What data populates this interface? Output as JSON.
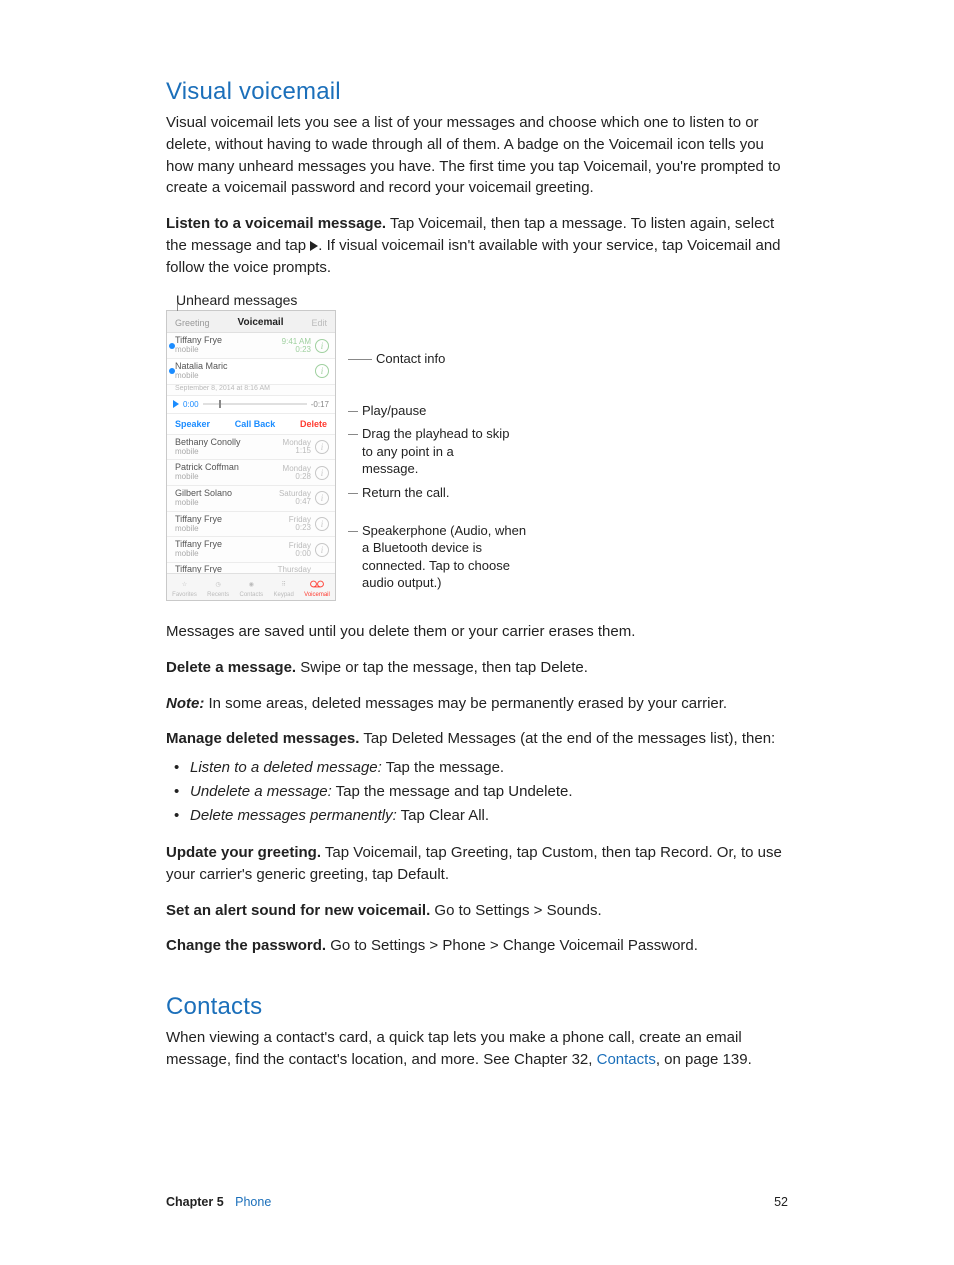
{
  "section1": {
    "title": "Visual voicemail",
    "intro": "Visual voicemail lets you see a list of your messages and choose which one to listen to or delete, without having to wade through all of them. A badge on the Voicemail icon tells you how many unheard messages you have. The first time you tap Voicemail, you're prompted to create a voicemail password and record your voicemail greeting.",
    "listen_bold": "Listen to a voicemail message.",
    "listen_rest_a": " Tap Voicemail, then tap a message. To listen again, select the message and tap ",
    "listen_rest_b": ". If visual voicemail isn't available with your service, tap Voicemail and follow the voice prompts."
  },
  "figure": {
    "top_caption": "Unheard messages",
    "header_greeting": "Greeting",
    "header_title": "Voicemail",
    "header_edit": "Edit",
    "rows": [
      {
        "name": "Tiffany Frye",
        "sub": "mobile",
        "ts1": "9:41 AM",
        "ts2": "0:23",
        "dot": true,
        "ts_grey": false
      },
      {
        "name": "Natalia Maric",
        "sub": "mobile",
        "ts1": "",
        "ts2": "",
        "dot": true,
        "ts_grey": false,
        "date_below": "September 8, 2014 at 8:16 AM"
      }
    ],
    "scrub_t0": "0:00",
    "scrub_t1": "-0:17",
    "actions": {
      "speaker": "Speaker",
      "callback": "Call Back",
      "delete": "Delete"
    },
    "rows2": [
      {
        "name": "Bethany Conolly",
        "sub": "mobile",
        "ts1": "Monday",
        "ts2": "1:15"
      },
      {
        "name": "Patrick Coffman",
        "sub": "mobile",
        "ts1": "Monday",
        "ts2": "0:28"
      },
      {
        "name": "Gilbert Solano",
        "sub": "mobile",
        "ts1": "Saturday",
        "ts2": "0:47"
      },
      {
        "name": "Tiffany Frye",
        "sub": "mobile",
        "ts1": "Friday",
        "ts2": "0:23"
      },
      {
        "name": "Tiffany Frye",
        "sub": "mobile",
        "ts1": "Friday",
        "ts2": "0:00"
      },
      {
        "name": "Tiffany Frye",
        "sub": "",
        "ts1": "Thursday",
        "ts2": ""
      }
    ],
    "tabs": [
      "Favorites",
      "Recents",
      "Contacts",
      "Keypad",
      "Voicemail"
    ],
    "callouts": {
      "contact_info": "Contact info",
      "play_pause": "Play/pause",
      "drag": "Drag the playhead to skip to any point in a message.",
      "return_call": "Return the call.",
      "speaker": "Speakerphone (Audio, when a Bluetooth device is connected. Tap to choose audio output.)"
    }
  },
  "after_fig": {
    "saved": "Messages are saved until you delete them or your carrier erases them.",
    "delete_bold": "Delete a message.",
    "delete_rest": " Swipe or tap the message, then tap Delete.",
    "note_label": "Note:  ",
    "note_rest": "In some areas, deleted messages may be permanently erased by your carrier.",
    "manage_bold": "Manage deleted messages.",
    "manage_rest": " Tap Deleted Messages (at the end of the messages list), then:",
    "bullets": [
      {
        "em": "Listen to a deleted message:",
        "rest": "  Tap the message."
      },
      {
        "em": "Undelete a message:",
        "rest": "  Tap the message and tap Undelete."
      },
      {
        "em": "Delete messages permanently:",
        "rest": "  Tap Clear All."
      }
    ],
    "update_bold": "Update your greeting.",
    "update_rest": " Tap Voicemail, tap Greeting, tap Custom, then tap Record. Or, to use your carrier's generic greeting, tap Default.",
    "alert_bold": "Set an alert sound for new voicemail.",
    "alert_rest": " Go to Settings > Sounds.",
    "pwd_bold": "Change the password.",
    "pwd_rest": " Go to Settings > Phone > Change Voicemail Password."
  },
  "section2": {
    "title": "Contacts",
    "body_a": "When viewing a contact's card, a quick tap lets you make a phone call, create an email message, find the contact's location, and more. See Chapter 32, ",
    "link": "Contacts",
    "body_b": ", on page 139."
  },
  "footer": {
    "chapter": "Chapter  5",
    "chapname": "Phone",
    "pagenum": "52"
  }
}
